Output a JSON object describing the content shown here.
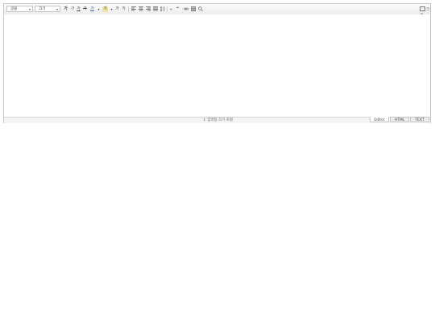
{
  "toolbar": {
    "font_select": {
      "value": "글꼴"
    },
    "size_select": {
      "value": "크기"
    },
    "format_buttons": [
      {
        "name": "bold-button",
        "label": "가"
      },
      {
        "name": "italic-button",
        "label": "가"
      },
      {
        "name": "underline-button",
        "label": "가"
      },
      {
        "name": "strikethrough-button",
        "label": "가"
      },
      {
        "name": "text-color-button",
        "label": "가"
      },
      {
        "name": "highlight-button",
        "label": "가"
      },
      {
        "name": "superscript-button",
        "label": "가"
      },
      {
        "name": "subscript-button",
        "label": "가"
      }
    ],
    "fullscreen_label": "크게"
  },
  "status_bar": {
    "resize_label": "↕ 입력창 크기 조절"
  },
  "mode_tabs": [
    {
      "label": "Editor",
      "active": true
    },
    {
      "label": "HTML",
      "active": false
    },
    {
      "label": "TEXT",
      "active": false
    }
  ]
}
